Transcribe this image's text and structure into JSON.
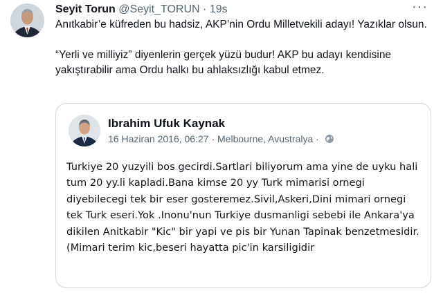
{
  "tweet": {
    "author_name": "Seyit Torun",
    "author_handle": "@Seyit_TORUN",
    "separator": "·",
    "time": "19s",
    "more_icon": "more-icon",
    "paragraph_1": "Anıtkabir’e küfreden bu hadsiz, AKP’nin Ordu Milletvekili adayı! Yazıklar olsun.",
    "paragraph_2": "“Yerli ve milliyiz” diyenlerin gerçek yüzü budur! AKP bu adayı kendisine yakıştırabilir ama Ordu halkı bu ahlaksızlığı kabul etmez."
  },
  "quoted_post": {
    "author_name": "Ibrahim Ufuk Kaynak",
    "date": "16 Haziran 2016, 06:27",
    "separator": "·",
    "location": "Melbourne, Avustralya",
    "separator_2": "·",
    "visibility_icon": "globe-icon",
    "body": "Turkiye 20 yuzyili bos gecirdi.Sartlari biliyorum ama yine de uyku hali tum 20 yy.li kapladi.Bana kimse 20 yy Turk mimarisi ornegi diyebilecegi tek bir eser gosteremez.Sivil,Askeri,Dini mimari ornegi tek Turk eseri.Yok .Inonu'nun Turkiye dusmanligi sebebi ile Ankara'ya dikilen Anitkabir \"Kic\" bir yapi ve pis bir Yunan Tapinak benzetmesidir.(Mimari terim kic,beseri hayatta pic'in karsiligidir"
  },
  "colors": {
    "text": "#0f1419",
    "secondary": "#536471",
    "border": "#cfd9de"
  }
}
